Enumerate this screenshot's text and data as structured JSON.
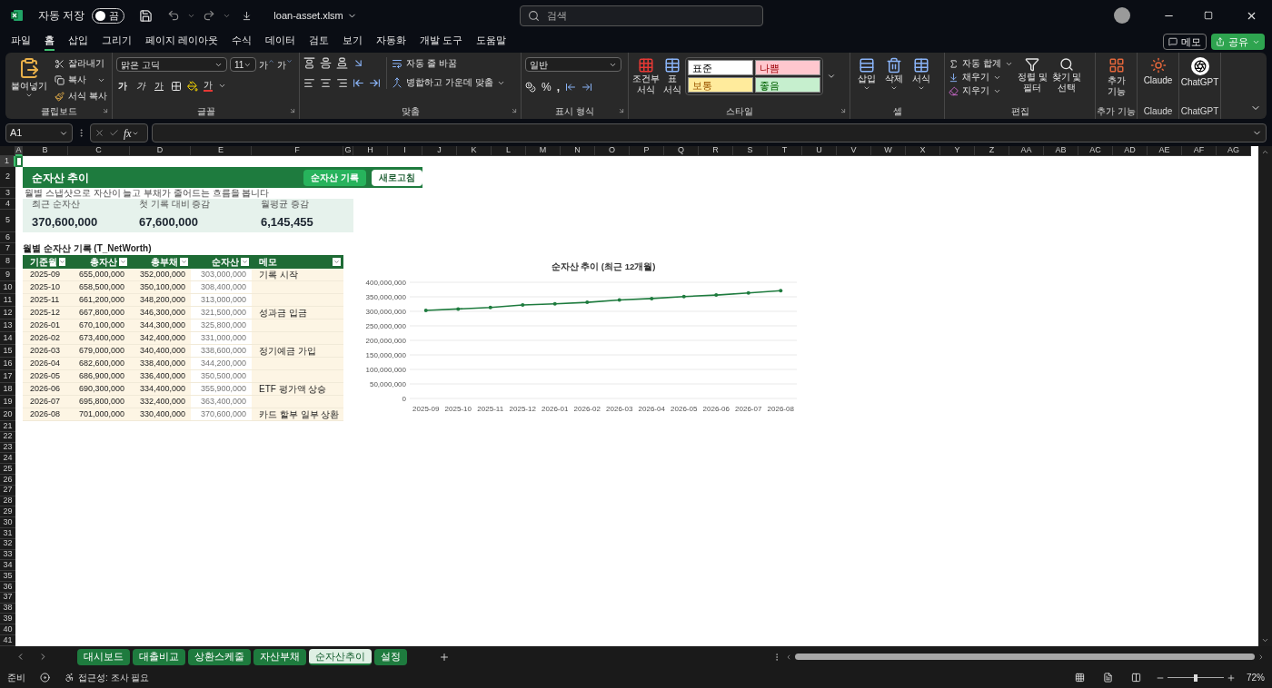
{
  "app": {
    "autosave_label": "자동 저장",
    "autosave_on": false,
    "autosave_state": "끔",
    "filename": "loan-asset.xlsm",
    "search": {
      "placeholder": "검색"
    }
  },
  "menu": [
    {
      "label": "파일",
      "selected": false
    },
    {
      "label": "홈",
      "selected": true
    },
    {
      "label": "삽입",
      "selected": false
    },
    {
      "label": "그리기",
      "selected": false
    },
    {
      "label": "페이지 레이아웃",
      "selected": false
    },
    {
      "label": "수식",
      "selected": false
    },
    {
      "label": "데이터",
      "selected": false
    },
    {
      "label": "검토",
      "selected": false
    },
    {
      "label": "보기",
      "selected": false
    },
    {
      "label": "자동화",
      "selected": false
    },
    {
      "label": "개발 도구",
      "selected": false
    },
    {
      "label": "도움말",
      "selected": false
    }
  ],
  "menu_actions": {
    "comments": "메모",
    "share": "공유"
  },
  "ribbon": {
    "clipboard": {
      "title": "클립보드",
      "paste": "붙여넣기",
      "cut": "잘라내기",
      "copy": "복사",
      "format_painter": "서식 복사"
    },
    "font": {
      "title": "글꼴",
      "face": "맑은 고딕",
      "size": "11",
      "grow": "가",
      "shrink": "가",
      "bold": "가",
      "italic": "가",
      "underline": "가",
      "font_color_button": "가"
    },
    "alignment": {
      "title": "맞춤",
      "wrap": "자동 줄 바꿈",
      "merge": "병합하고 가운데 맞춤"
    },
    "number": {
      "title": "표시 형식",
      "format": "일반",
      "percent": "%",
      "comma": ","
    },
    "styles": {
      "title": "스타일",
      "conditional": [
        "조건부",
        "서식"
      ],
      "table": [
        "표",
        "서식"
      ],
      "gallery": [
        {
          "label": "표준",
          "kind": "normal",
          "color": "#ffffff"
        },
        {
          "label": "나쁨",
          "kind": "bad",
          "color": "#ffc7ce"
        },
        {
          "label": "보통",
          "kind": "neutral",
          "color": "#ffeb9c"
        },
        {
          "label": "좋음",
          "kind": "good",
          "color": "#c6efce"
        }
      ]
    },
    "cells": {
      "title": "셀",
      "items": [
        {
          "label": "삽입",
          "kind": "insert"
        },
        {
          "label": "삭제",
          "kind": "delete"
        },
        {
          "label": "서식",
          "kind": "format"
        }
      ]
    },
    "editing": {
      "title": "편집",
      "autosum": "자동 합계",
      "fill": "채우기",
      "clear": "지우기",
      "sort": [
        "정렬 및",
        "필터"
      ],
      "find": [
        "찾기 및",
        "선택"
      ]
    },
    "addins": [
      {
        "label": [
          "추가",
          "기능"
        ],
        "title": "추가 기능",
        "kind": "addins"
      },
      {
        "label": [
          "Claude"
        ],
        "title": "Claude",
        "kind": "claude"
      },
      {
        "label": [
          "ChatGPT"
        ],
        "title": "ChatGPT",
        "kind": "chatgpt"
      }
    ]
  },
  "formula_bar": {
    "name_box": "A1",
    "fx": "fx"
  },
  "sheet": {
    "columns": [
      {
        "label": "A",
        "selected": true
      },
      {
        "label": "B",
        "selected": false
      },
      {
        "label": "C",
        "selected": false
      },
      {
        "label": "D",
        "selected": false
      },
      {
        "label": "E",
        "selected": false
      },
      {
        "label": "F",
        "selected": false
      },
      {
        "label": "G",
        "selected": false
      },
      {
        "label": "H",
        "selected": false
      },
      {
        "label": "I",
        "selected": false
      },
      {
        "label": "J",
        "selected": false
      },
      {
        "label": "K",
        "selected": false
      },
      {
        "label": "L",
        "selected": false
      },
      {
        "label": "M",
        "selected": false
      },
      {
        "label": "N",
        "selected": false
      },
      {
        "label": "O",
        "selected": false
      },
      {
        "label": "P",
        "selected": false
      },
      {
        "label": "Q",
        "selected": false
      },
      {
        "label": "R",
        "selected": false
      },
      {
        "label": "S",
        "selected": false
      },
      {
        "label": "T",
        "selected": false
      },
      {
        "label": "U",
        "selected": false
      },
      {
        "label": "V",
        "selected": false
      },
      {
        "label": "W",
        "selected": false
      },
      {
        "label": "X",
        "selected": false
      },
      {
        "label": "Y",
        "selected": false
      },
      {
        "label": "Z",
        "selected": false
      },
      {
        "label": "AA",
        "selected": false
      },
      {
        "label": "AB",
        "selected": false
      },
      {
        "label": "AC",
        "selected": false
      },
      {
        "label": "AD",
        "selected": false
      },
      {
        "label": "AE",
        "selected": false
      },
      {
        "label": "AF",
        "selected": false
      },
      {
        "label": "AG",
        "selected": false
      }
    ],
    "rows": [
      {
        "label": "1",
        "selected": true
      },
      {
        "label": "2",
        "selected": false
      },
      {
        "label": "3",
        "selected": false
      },
      {
        "label": "4",
        "selected": false
      },
      {
        "label": "5",
        "selected": false
      },
      {
        "label": "6",
        "selected": false
      },
      {
        "label": "7",
        "selected": false
      },
      {
        "label": "8",
        "selected": false
      },
      {
        "label": "9",
        "selected": false
      },
      {
        "label": "10",
        "selected": false
      },
      {
        "label": "11",
        "selected": false
      },
      {
        "label": "12",
        "selected": false
      },
      {
        "label": "13",
        "selected": false
      },
      {
        "label": "14",
        "selected": false
      },
      {
        "label": "15",
        "selected": false
      },
      {
        "label": "16",
        "selected": false
      },
      {
        "label": "17",
        "selected": false
      },
      {
        "label": "18",
        "selected": false
      },
      {
        "label": "19",
        "selected": false
      },
      {
        "label": "20",
        "selected": false
      },
      {
        "label": "21",
        "selected": false
      },
      {
        "label": "22",
        "selected": false
      },
      {
        "label": "23",
        "selected": false
      },
      {
        "label": "24",
        "selected": false
      },
      {
        "label": "25",
        "selected": false
      },
      {
        "label": "26",
        "selected": false
      },
      {
        "label": "27",
        "selected": false
      },
      {
        "label": "28",
        "selected": false
      },
      {
        "label": "29",
        "selected": false
      },
      {
        "label": "30",
        "selected": false
      },
      {
        "label": "31",
        "selected": false
      },
      {
        "label": "32",
        "selected": false
      },
      {
        "label": "33",
        "selected": false
      },
      {
        "label": "34",
        "selected": false
      },
      {
        "label": "35",
        "selected": false
      },
      {
        "label": "36",
        "selected": false
      },
      {
        "label": "37",
        "selected": false
      },
      {
        "label": "38",
        "selected": false
      },
      {
        "label": "39",
        "selected": false
      },
      {
        "label": "40",
        "selected": false
      },
      {
        "label": "41",
        "selected": false
      }
    ],
    "dashboard": {
      "title": "순자산 추이",
      "buttons": [
        {
          "label": "순자산 기록",
          "kind": "primary"
        },
        {
          "label": "새로고침",
          "kind": "secondary"
        }
      ],
      "subtitle": "월별 스냅샷으로 자산이 늘고 부채가 줄어드는 흐름을 봅니다",
      "kpis": [
        {
          "label": "최근 순자산",
          "value": "370,600,000"
        },
        {
          "label": "첫 기록 대비 증감",
          "value": "67,600,000"
        },
        {
          "label": "월평균 증감",
          "value": "6,145,455"
        }
      ]
    },
    "table": {
      "title": "월별 순자산 기록 (T_NetWorth)",
      "columns": [
        "기준월",
        "총자산",
        "총부채",
        "순자산",
        "메모"
      ],
      "rows": [
        {
          "month": "2025-09",
          "assets": "655,000,000",
          "debts": "352,000,000",
          "net": "303,000,000",
          "memo": "기록 시작"
        },
        {
          "month": "2025-10",
          "assets": "658,500,000",
          "debts": "350,100,000",
          "net": "308,400,000"
        },
        {
          "month": "2025-11",
          "assets": "661,200,000",
          "debts": "348,200,000",
          "net": "313,000,000"
        },
        {
          "month": "2025-12",
          "assets": "667,800,000",
          "debts": "346,300,000",
          "net": "321,500,000",
          "memo": "성과금 입금"
        },
        {
          "month": "2026-01",
          "assets": "670,100,000",
          "debts": "344,300,000",
          "net": "325,800,000"
        },
        {
          "month": "2026-02",
          "assets": "673,400,000",
          "debts": "342,400,000",
          "net": "331,000,000"
        },
        {
          "month": "2026-03",
          "assets": "679,000,000",
          "debts": "340,400,000",
          "net": "338,600,000",
          "memo": "정기예금 가입"
        },
        {
          "month": "2026-04",
          "assets": "682,600,000",
          "debts": "338,400,000",
          "net": "344,200,000"
        },
        {
          "month": "2026-05",
          "assets": "686,900,000",
          "debts": "336,400,000",
          "net": "350,500,000"
        },
        {
          "month": "2026-06",
          "assets": "690,300,000",
          "debts": "334,400,000",
          "net": "355,900,000",
          "memo": "ETF 평가액 상승"
        },
        {
          "month": "2026-07",
          "assets": "695,800,000",
          "debts": "332,400,000",
          "net": "363,400,000"
        },
        {
          "month": "2026-08",
          "assets": "701,000,000",
          "debts": "330,400,000",
          "net": "370,600,000",
          "memo": "카드 할부 일부 상환"
        }
      ]
    },
    "chart": {
      "chart_data": {
        "type": "line",
        "title": "순자산 추이 (최근 12개월)",
        "categories": [
          "2025-09",
          "2025-10",
          "2025-11",
          "2025-12",
          "2026-01",
          "2026-02",
          "2026-03",
          "2026-04",
          "2026-05",
          "2026-06",
          "2026-07",
          "2026-08"
        ],
        "series": [
          {
            "color": "#1e7b3e",
            "values": [
              303000000,
              308000000,
              313000000,
              322000000,
              326000000,
              331000000,
              339000000,
              344000000,
              351000000,
              356000000,
              363000000,
              371000000
            ]
          }
        ],
        "grid": true,
        "ylim": [
          0,
          400000000
        ],
        "yticks": [
          {
            "value": 0,
            "label": "0"
          },
          {
            "value": 50000000,
            "label": "50,000,000"
          },
          {
            "value": 100000000,
            "label": "100,000,000"
          },
          {
            "value": 150000000,
            "label": "150,000,000"
          },
          {
            "value": 200000000,
            "label": "200,000,000"
          },
          {
            "value": 250000000,
            "label": "250,000,000"
          },
          {
            "value": 300000000,
            "label": "300,000,000"
          },
          {
            "value": 350000000,
            "label": "350,000,000"
          },
          {
            "value": 400000000,
            "label": "400,000,000"
          }
        ]
      }
    }
  },
  "sheet_tabs": [
    {
      "label": "대시보드",
      "selected": false
    },
    {
      "label": "대출비교",
      "selected": false
    },
    {
      "label": "상환스케줄",
      "selected": false
    },
    {
      "label": "자산부채",
      "selected": false
    },
    {
      "label": "순자산추이",
      "selected": true
    },
    {
      "label": "설정",
      "selected": false
    }
  ],
  "status_bar": {
    "ready": "준비",
    "accessibility": "접근성: 조사 필요",
    "zoom_slider": {
      "level": 0.5
    },
    "zoom": "72%"
  }
}
